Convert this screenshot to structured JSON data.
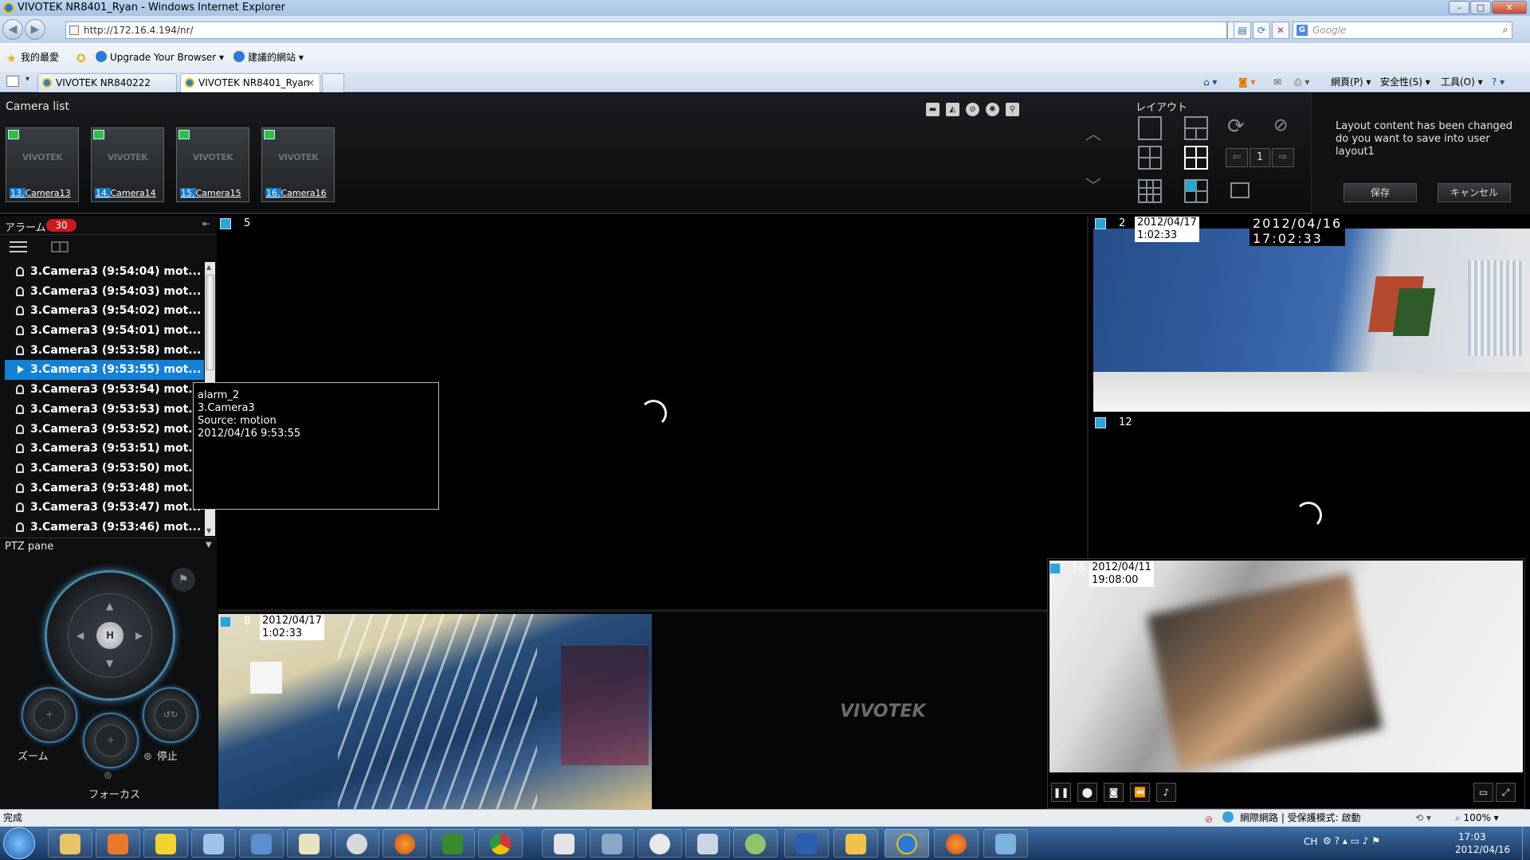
{
  "window": {
    "title": "VIVOTEK NR8401_Ryan - Windows Internet Explorer",
    "url": "http://172.16.4.194/nr/",
    "search_placeholder": "Google"
  },
  "favorites": {
    "favorites_label": "我的最愛",
    "upgrade_label": "Upgrade Your Browser ▾",
    "suggested_label": "建議的網站 ▾"
  },
  "tabs": [
    {
      "label": "VIVOTEK NR840222"
    },
    {
      "label": "VIVOTEK NR8401_Ryan"
    }
  ],
  "commands": {
    "page": "網頁(P) ▾",
    "safety": "安全性(S) ▾",
    "tools": "工具(O) ▾",
    "help": "? ▾"
  },
  "camera_list": {
    "label": "Camera list",
    "cameras": [
      {
        "num": "13.",
        "name": "Camera13",
        "logo": "VIVOTEK"
      },
      {
        "num": "14.",
        "name": "Camera14",
        "logo": "VIVOTEK"
      },
      {
        "num": "15.",
        "name": "Camera15",
        "logo": "VIVOTEK"
      },
      {
        "num": "16.",
        "name": "Camera16",
        "logo": "VIVOTEK"
      }
    ]
  },
  "layout": {
    "label": "レイアウト",
    "page_number": "1",
    "message": "Layout content has been changed do you want to save into user layout1",
    "save_label": "保存",
    "cancel_label": "キャンセル"
  },
  "alarms": {
    "label": "アラーム",
    "count": "30",
    "items": [
      "3.Camera3 (9:54:04) mot...",
      "3.Camera3 (9:54:03) mot...",
      "3.Camera3 (9:54:02) mot...",
      "3.Camera3 (9:54:01) mot...",
      "3.Camera3 (9:53:58) mot...",
      "3.Camera3 (9:53:55) mot...",
      "3.Camera3 (9:53:54) mot...",
      "3.Camera3 (9:53:53) mot...",
      "3.Camera3 (9:53:52) mot...",
      "3.Camera3 (9:53:51) mot...",
      "3.Camera3 (9:53:50) mot...",
      "3.Camera3 (9:53:48) mot...",
      "3.Camera3 (9:53:47) mot...",
      "3.Camera3 (9:53:46) mot..."
    ],
    "selected_index": 5,
    "tooltip": {
      "line1": "alarm_2",
      "line2": "3.Camera3",
      "line3": "Source: motion",
      "line4": "2012/04/16 9:53:55"
    }
  },
  "ptz": {
    "label": "PTZ pane",
    "home_label": "H",
    "zoom_label": "ズーム",
    "stop_label": "停止",
    "focus_label": "フォーカス"
  },
  "video": {
    "tile5": {
      "num": "5"
    },
    "tile2": {
      "num": "2",
      "timestamp": "2012/04/17 1:02:33",
      "overlay": "2012/04/16 17:02:33"
    },
    "tile12": {
      "num": "12"
    },
    "tile8": {
      "num": "8",
      "timestamp": "2012/04/17 1:02:33"
    },
    "tile16": {
      "num": "16",
      "timestamp": "2012/04/11 19:08:00"
    },
    "center_logo": "VIVOTEK"
  },
  "statusbar": {
    "left": "完成",
    "zone": "網際網路 | 受保護模式: 啟動",
    "zoom": "100%"
  },
  "taskbar": {
    "ime": "CH",
    "time": "17:03",
    "date": "2012/04/16"
  },
  "colors": {
    "accent": "#1381d8",
    "alarm_badge": "#c81a1a",
    "camera_ok": "#2fbf45"
  }
}
